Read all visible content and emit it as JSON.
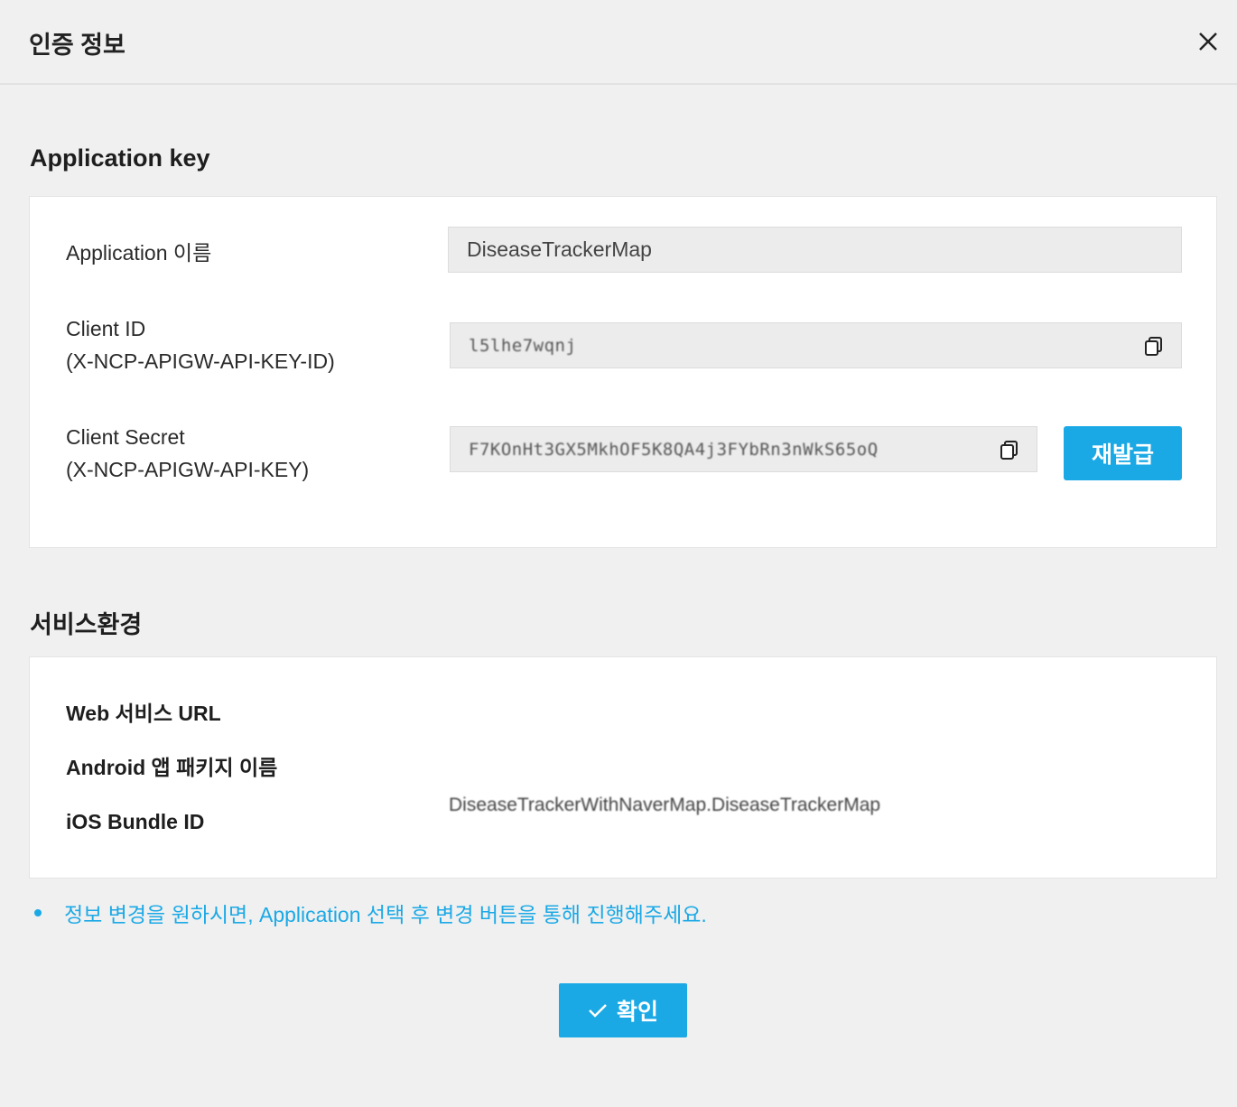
{
  "dialog": {
    "title": "인증 정보"
  },
  "app_key": {
    "section_title": "Application key",
    "app_name_label": "Application 이름",
    "app_name_value": "DiseaseTrackerMap",
    "client_id_label_1": "Client ID",
    "client_id_label_2": "(X-NCP-APIGW-API-KEY-ID)",
    "client_id_value": "l5lhe7wqnj",
    "client_secret_label_1": "Client Secret",
    "client_secret_label_2": "(X-NCP-APIGW-API-KEY)",
    "client_secret_value": "F7KOnHt3GX5MkhOF5K8QA4j3FYbRn3nWkS65oQ",
    "reissue_label": "재발급"
  },
  "service": {
    "section_title": "서비스환경",
    "web_label": "Web 서비스 URL",
    "android_label": "Android 앱 패키지 이름",
    "ios_label": "iOS Bundle ID",
    "ios_value": "DiseaseTrackerWithNaverMap.DiseaseTrackerMap"
  },
  "note": "정보 변경을 원하시면, Application 선택 후 변경 버튼을 통해 진행해주세요.",
  "confirm_label": "확인",
  "icons": {
    "close": "close-icon",
    "copy": "copy-icon",
    "check": "check-icon"
  },
  "colors": {
    "accent": "#1ba9e6",
    "background": "#f0f0f0"
  }
}
